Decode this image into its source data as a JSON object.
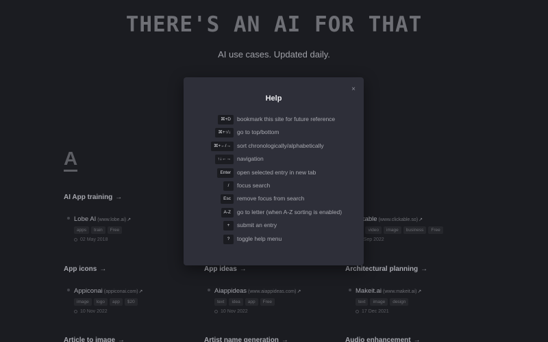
{
  "hero": {
    "title": "THERE'S AN AI FOR THAT",
    "subtitle": "AI use cases. Updated daily."
  },
  "letter": "A",
  "categories": [
    {
      "label": "AI App training",
      "arrow": "→"
    },
    {
      "label": "App icons",
      "arrow": "→"
    },
    {
      "label": "App ideas",
      "arrow": "→"
    },
    {
      "label": "Architectural planning",
      "arrow": "→"
    },
    {
      "label": "Article to image",
      "arrow": "→"
    },
    {
      "label": "Artist name generation",
      "arrow": "→"
    },
    {
      "label": "Audio enhancement",
      "arrow": "→"
    }
  ],
  "entries": [
    {
      "name": "Lobe AI",
      "domain": "(www.lobe.ai)",
      "tags": [
        "apps",
        "train",
        "Free"
      ],
      "date": "02 May 2018"
    },
    {
      "name": "Clickable",
      "domain": "(www.clickable.so)",
      "tags": [
        "ads",
        "video",
        "image",
        "business",
        "Free"
      ],
      "date": "21 Sep 2022"
    },
    {
      "name": "Appiconai",
      "domain": "(appiconai.com)",
      "tags": [
        "image",
        "logo",
        "app",
        "$20"
      ],
      "date": "10 Nov 2022"
    },
    {
      "name": "Aiappideas",
      "domain": "(www.aiappideas.com)",
      "tags": [
        "text",
        "idea",
        "app",
        "Free"
      ],
      "date": "10 Nov 2022"
    },
    {
      "name": "Makeit.ai",
      "domain": "(www.makeit.ai)",
      "tags": [
        "text",
        "image",
        "design"
      ],
      "date": "17 Dec 2021"
    }
  ],
  "modal": {
    "title": "Help",
    "close": "×",
    "shortcuts": [
      {
        "key": "⌘+D",
        "desc": "bookmark this site for future reference"
      },
      {
        "key": "⌘+↑/↓",
        "desc": "go to top/bottom"
      },
      {
        "key": "⌘+←/→",
        "desc": "sort chronologically/alphabetically"
      },
      {
        "key": "↑↓←→",
        "desc": "navigation"
      },
      {
        "key": "Enter",
        "desc": "open selected entry in new tab"
      },
      {
        "key": "/",
        "desc": "focus search"
      },
      {
        "key": "Esc",
        "desc": "remove focus from search"
      },
      {
        "key": "A-Z",
        "desc": "go to letter (when A-Z sorting is enabled)"
      },
      {
        "key": "+",
        "desc": "submit an entry"
      },
      {
        "key": "?",
        "desc": "toggle help menu"
      }
    ]
  }
}
